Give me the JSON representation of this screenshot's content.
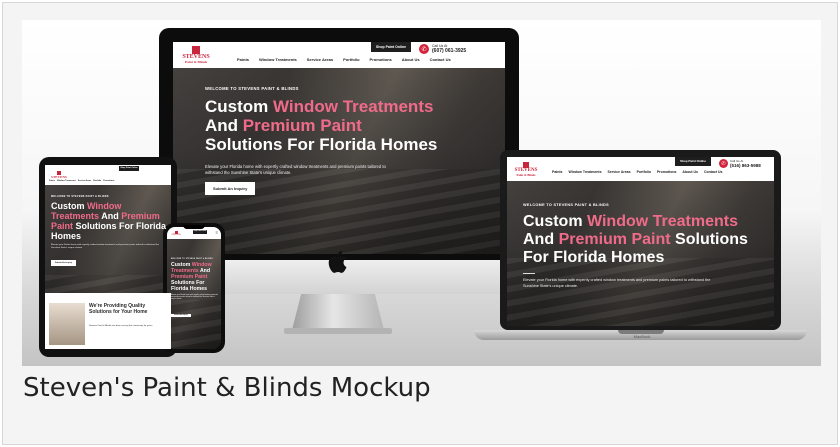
{
  "caption": "Steven's Paint & Blinds Mockup",
  "site": {
    "logo_name": "STEVENS",
    "logo_sub": "Paint & Blinds",
    "nav": [
      "Paints",
      "Window Treatments",
      "Service Areas",
      "Portfolio",
      "Promotions",
      "About Us",
      "Contact Us"
    ],
    "shop_label": "Shop Paint Online",
    "phone_label": "Call Us At",
    "imac_phone": "(607) 061-3925",
    "laptop_phone": "(516) 863-5988",
    "eyebrow": "WELCOME TO STEVENS PAINT & BLINDS",
    "headline": {
      "p1": "Custom",
      "p2": "Window Treatments",
      "p3": "And",
      "p4": "Premium Paint",
      "p5": "Solutions For Florida Homes"
    },
    "description": "Elevate your Florida home with expertly crafted window treatments and premium paints tailored to withstand the Sunshine State's unique climate.",
    "cta": "Submit An Inquiry",
    "tablet_band_heading": "We're Providing Quality Solutions for Your Home",
    "tablet_band_copy": "Stevens Paint & Blinds has been serving the community for years.",
    "laptop_brand": "MacBook"
  },
  "colors": {
    "accent_pink": "#f06b8a",
    "brand_red": "#c8263c",
    "dark": "#1e1e1e"
  }
}
